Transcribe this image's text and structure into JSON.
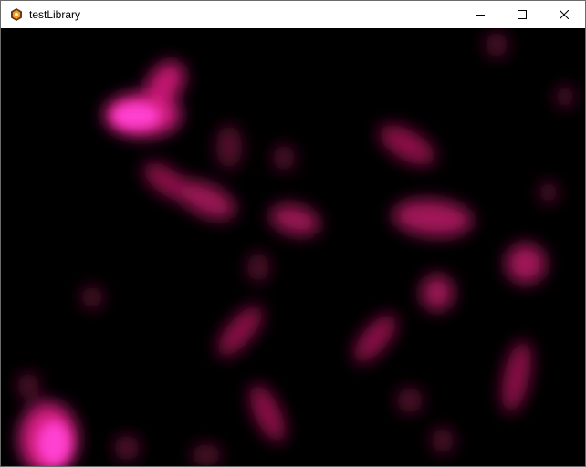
{
  "window": {
    "title": "testLibrary",
    "icon": "app-hexagon-icon",
    "controls": [
      "minimize-icon",
      "maximize-icon",
      "close-icon"
    ]
  },
  "colors": {
    "blob_core": "#ff3fd0",
    "blob_mid": "#d41b80",
    "blob_dark": "#8f0e4a",
    "canvas_bg": "#000000"
  }
}
